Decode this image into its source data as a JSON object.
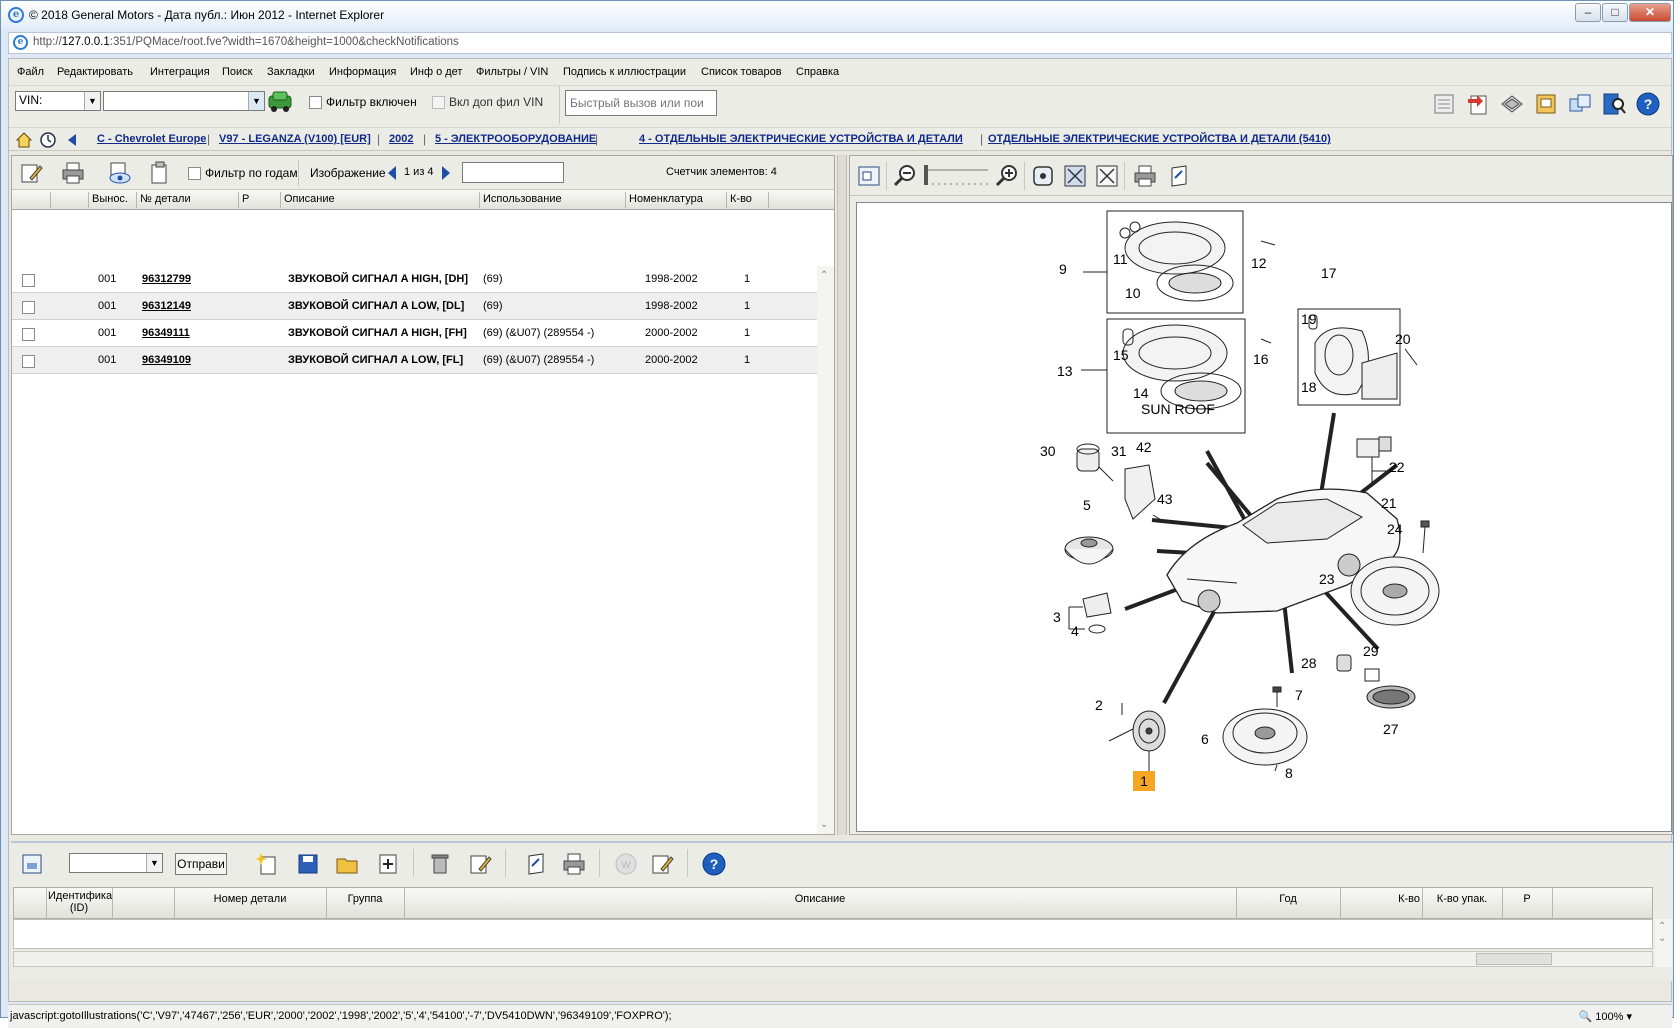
{
  "window": {
    "title": "© 2018 General Motors - Дата публ.: Июн 2012 - Internet Explorer",
    "url_prefix": "http://",
    "url_host": "127.0.0.1",
    "url_rest": ":351/PQMace/root.fve?width=1670&height=1000&checkNotifications"
  },
  "menu": [
    "Файл",
    "Редактировать",
    "Интеграция",
    "Поиск",
    "Закладки",
    "Информация",
    "Инф о дет",
    "Фильтры / VIN",
    "Подпись к иллюстрации",
    "Список товаров",
    "Справка"
  ],
  "toolbar1": {
    "vin_label": "VIN:",
    "vin_value": "",
    "filter_on_label": "Фильтр включен",
    "vin_filter_label": "Вкл доп фил VIN",
    "quick_call_placeholder": "Быстрый вызов или пои"
  },
  "breadcrumb": [
    "C - Chevrolet Europe",
    "V97 - LEGANZA (V100) [EUR]",
    "2002",
    "5 - ЭЛЕКТРООБОРУДОВАНИЕ",
    "4 - ОТДЕЛЬНЫЕ ЭЛЕКТРИЧЕСКИЕ УСТРОЙСТВА И ДЕТАЛИ",
    "ОТДЕЛЬНЫЕ ЭЛЕКТРИЧЕСКИЕ УСТРОЙСТВА И ДЕТАЛИ  (5410)"
  ],
  "parts_panel": {
    "year_filter_label": "Фильтр по годам",
    "image_label": "Изображение",
    "image_pager": "1 из 4",
    "counter_label": "Счетчик элементов: 4",
    "columns": [
      "Вынос.",
      "№ детали",
      "Р",
      "Описание",
      "Использование",
      "Номенклатура",
      "К-во"
    ],
    "rows": [
      {
        "callout": "001",
        "part": "96312799",
        "p": "",
        "desc": "ЗВУКОВОЙ СИГНАЛ A HIGH, [DH]",
        "usage": "(69)",
        "nomen": "1998-2002",
        "qty": "1"
      },
      {
        "callout": "001",
        "part": "96312149",
        "p": "",
        "desc": "ЗВУКОВОЙ СИГНАЛ A LOW, [DL]",
        "usage": "(69)",
        "nomen": "1998-2002",
        "qty": "1"
      },
      {
        "callout": "001",
        "part": "96349111",
        "p": "",
        "desc": "ЗВУКОВОЙ СИГНАЛ A HIGH, [FH]",
        "usage": "(69) (&U07) (289554 -)",
        "nomen": "2000-2002",
        "qty": "1"
      },
      {
        "callout": "001",
        "part": "96349109",
        "p": "",
        "desc": "ЗВУКОВОЙ СИГНАЛ A LOW, [FL]",
        "usage": "(69) (&U07) (289554 -)",
        "nomen": "2000-2002",
        "qty": "1"
      }
    ]
  },
  "illustration": {
    "sun_roof_label": "SUN ROOF",
    "callouts": [
      "9",
      "11",
      "10",
      "12",
      "17",
      "19",
      "20",
      "18",
      "13",
      "15",
      "16",
      "14",
      "30",
      "31",
      "42",
      "43",
      "22",
      "21",
      "5",
      "24",
      "23",
      "3",
      "4",
      "28",
      "29",
      "27",
      "2",
      "7",
      "6",
      "8",
      "1"
    ],
    "highlighted_callout": "1"
  },
  "bottom_panel": {
    "send_label": "Отправи",
    "columns": [
      "Идентифика (ID)",
      "Номер детали",
      "Группа",
      "Описание",
      "Год",
      "К-во",
      "К-во упак.",
      "Р"
    ]
  },
  "statusbar": {
    "text": "javascript:gotoIllustrations('C','V97','47467','256','EUR','2000','2002','1998','2002','5','4','54100','-7','DV5410DWN','96349109','FOXPRO');",
    "zoom": "100%"
  },
  "colors": {
    "link": "#0f2a8a",
    "highlight_callout": "#f5a623",
    "chrome": "#dfe9f5"
  }
}
